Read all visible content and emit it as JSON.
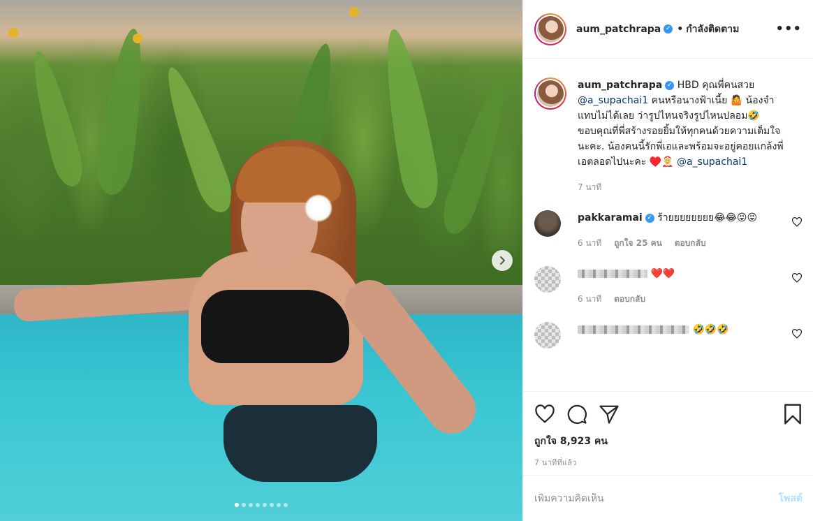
{
  "header": {
    "username": "aum_patchrapa",
    "verified_icon": "check",
    "separator": "•",
    "follow_state": "กำลังติดตาม",
    "more": "•••"
  },
  "caption": {
    "username": "aum_patchrapa",
    "text_a": "HBD คุณพี่คนสวย",
    "mention_1": "@a_supachai1",
    "text_b": "คนหรือนางฟ้าเนี้ย 🤷 น้องจำแทบไม่ได้เลย ว่ารูปไหนจริงรูปไหนปลอม🤣 ขอบคุณที่พี่สร้างรอยยิ้มให้ทุกคนด้วยความเต็มใจนะคะ. น้องคนนี้รักพี่เอและพร้อมจะอยู่คอยแกล้งพี่เอตลอดไปนะคะ ♥️🤶",
    "mention_2": "@a_supachai1",
    "time": "7 นาที"
  },
  "comments": [
    {
      "username": "pakkaramai",
      "text": "ร้ายยยยยยยย😂😂😝😝",
      "time": "6 นาที",
      "likes": "ถูกใจ 25 คน",
      "reply": "ตอบกลับ"
    },
    {
      "username": "",
      "text": "❤️❤️",
      "time": "6 นาที",
      "reply": "ตอบกลับ"
    },
    {
      "username": "",
      "text": "🤣🤣🤣"
    }
  ],
  "actions": {
    "likes": "ถูกใจ 8,923 คน",
    "posted": "7 นาทีที่แล้ว"
  },
  "composer": {
    "placeholder": "เพิ่มความคิดเห็น",
    "post_label": "โพสต์"
  },
  "colors": {
    "link": "#00376b",
    "muted": "#8e8e8e",
    "verified": "#3897f0",
    "post_disabled": "#b2dffc"
  },
  "carousel": {
    "slides": 8,
    "active": 0
  }
}
